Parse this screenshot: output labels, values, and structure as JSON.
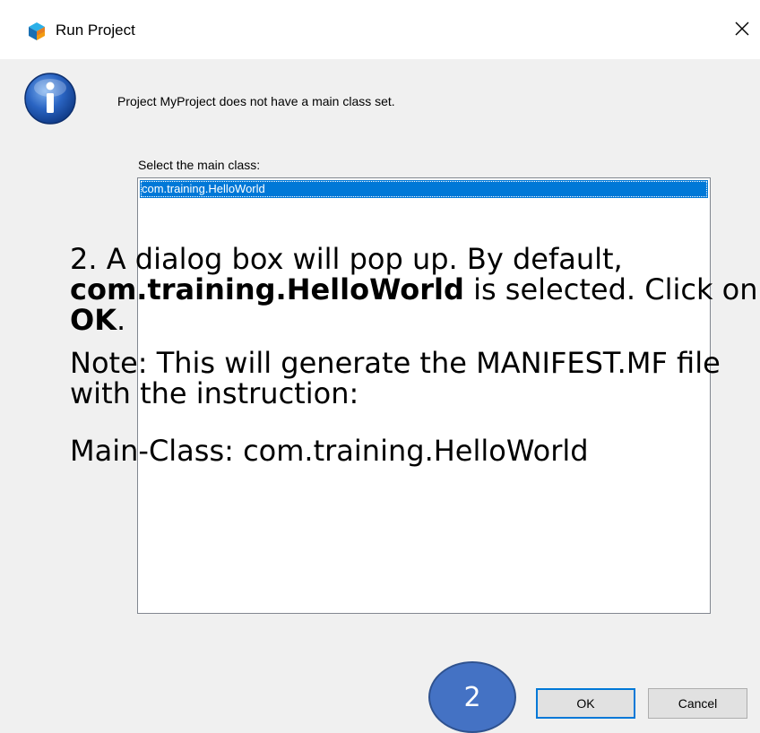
{
  "window": {
    "title": "Run Project",
    "app_icon": "netbeans-cube-icon",
    "close_icon": "close-icon"
  },
  "dialog": {
    "info_icon": "info-icon",
    "message": "Project MyProject does not have a main class set.",
    "select_label": "Select the main class:",
    "classes": [
      "com.training.HelloWorld"
    ],
    "selected_index": 0
  },
  "overlay": {
    "step_prefix": "2. A dialog box will pop up. By default, ",
    "step_class": "com.training.HelloWorld",
    "step_middle": " is selected. Click on ",
    "step_ok": "OK",
    "step_suffix": ".",
    "note": "Note: This will generate the MANIFEST.MF file with the instruction:",
    "main_class_line": "Main-Class: com.training.HelloWorld"
  },
  "callout": {
    "label": "2"
  },
  "buttons": {
    "ok_label": "OK",
    "cancel_label": "Cancel"
  },
  "colors": {
    "selection": "#0078d7",
    "callout_fill": "#4472c4",
    "dialog_bg": "#f0f0f0"
  }
}
